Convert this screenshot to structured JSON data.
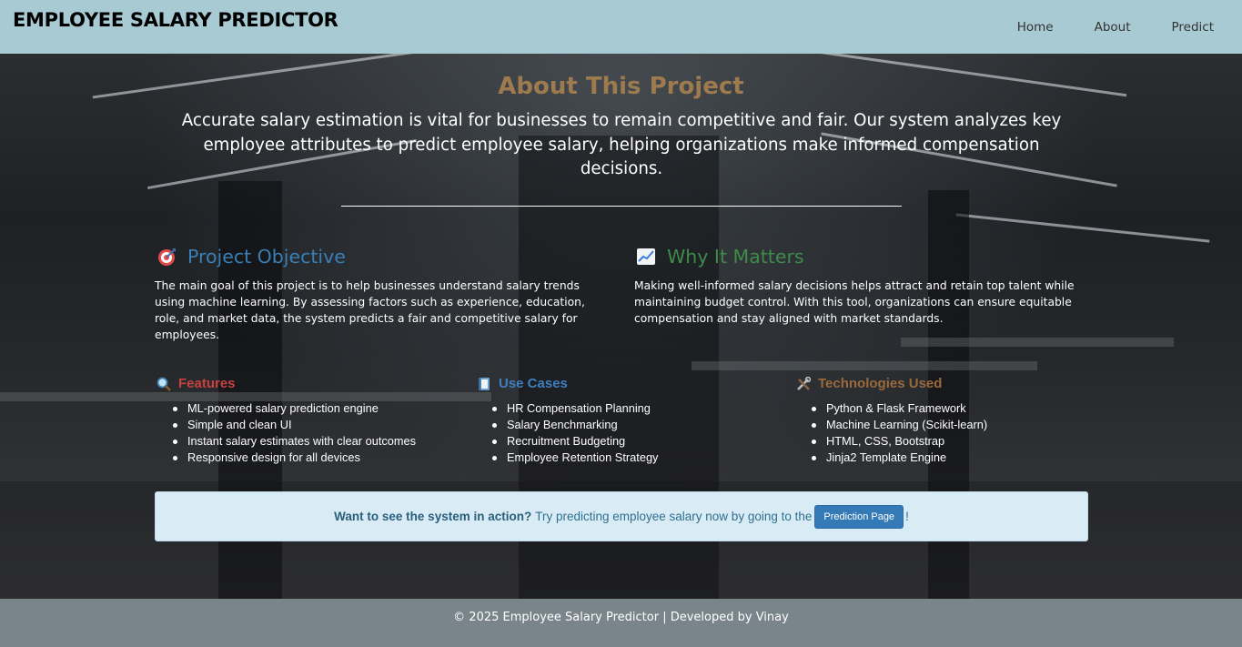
{
  "header": {
    "brand": "EMPLOYEE SALARY PREDICTOR",
    "nav": [
      {
        "label": "Home"
      },
      {
        "label": "About"
      },
      {
        "label": "Predict"
      }
    ]
  },
  "about": {
    "title": "About This Project",
    "intro": "Accurate salary estimation is vital for businesses to remain competitive and fair. Our system analyzes key employee attributes to predict employee salary, helping organizations make informed compensation decisions."
  },
  "objective": {
    "icon": "target-icon",
    "title": "Project Objective",
    "text": "The main goal of this project is to help businesses understand salary trends using machine learning. By assessing factors such as experience, education, role, and market data, the system predicts a fair and competitive salary for employees."
  },
  "why": {
    "icon": "chart-increasing-icon",
    "title": "Why It Matters",
    "text": "Making well-informed salary decisions helps attract and retain top talent while maintaining budget control. With this tool, organizations can ensure equitable compensation and stay aligned with market standards."
  },
  "features": {
    "icon": "magnifier-icon",
    "title": "Features",
    "items": [
      "ML-powered salary prediction engine",
      "Simple and clean UI",
      "Instant salary estimates with clear outcomes",
      "Responsive design for all devices"
    ]
  },
  "use_cases": {
    "icon": "ledger-icon",
    "title": "Use Cases",
    "items": [
      "HR Compensation Planning",
      "Salary Benchmarking",
      "Recruitment Budgeting",
      "Employee Retention Strategy"
    ]
  },
  "technologies": {
    "icon": "tools-icon",
    "title": "Technologies Used",
    "items": [
      "Python & Flask Framework",
      "Machine Learning (Scikit-learn)",
      "HTML, CSS, Bootstrap",
      "Jinja2 Template Engine"
    ]
  },
  "cta": {
    "lead": "Want to see the system in action?",
    "text": "Try predicting employee salary now by going to the",
    "button": "Prediction Page",
    "end": "!"
  },
  "footer": {
    "text": "© 2025 Employee Salary Predictor | Developed by Vinay"
  },
  "colors": {
    "navbar": "#a8cbd3",
    "about_title": "#9e7b4f",
    "objective_title": "#3a7fb5",
    "why_title": "#3e8b4a",
    "features_title": "#c9413f",
    "use_cases_title": "#3f7fc0",
    "technologies_title": "#9b6a3c",
    "cta_bg": "#d9ecf6",
    "button": "#337ab7",
    "footer": "#7a848b"
  }
}
